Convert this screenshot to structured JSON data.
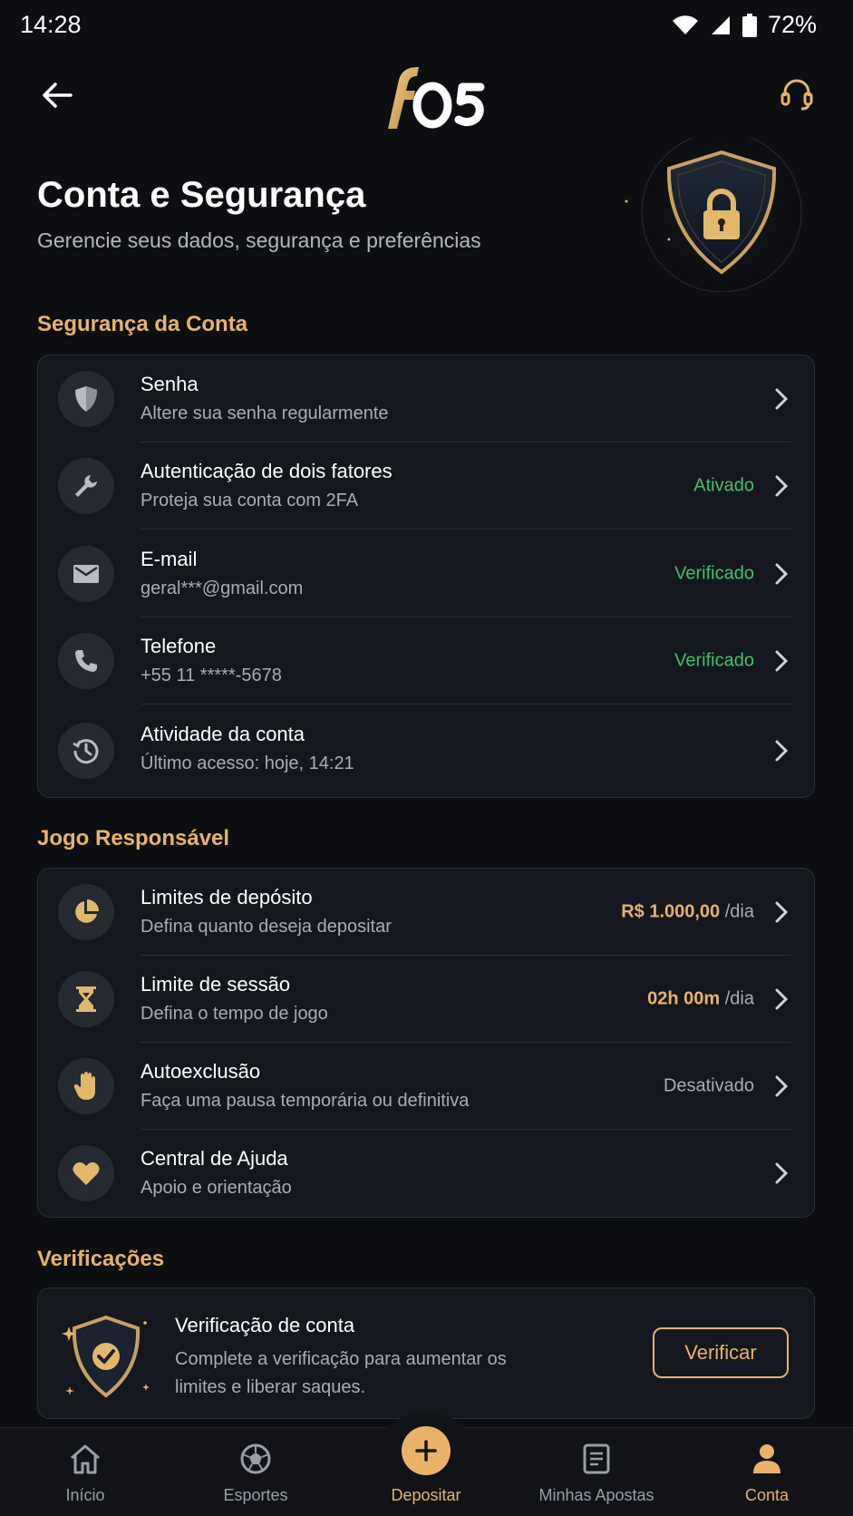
{
  "status_bar": {
    "time": "14:28",
    "battery": "72%"
  },
  "header": {
    "logo_text": "f05"
  },
  "hero": {
    "title": "Conta e Segurança",
    "subtitle": "Gerencie seus dados, segurança e preferências"
  },
  "sections": {
    "security_title": "Segurança da Conta",
    "responsible_title": "Jogo Responsável",
    "verifications_title": "Verificações"
  },
  "security_rows": [
    {
      "title": "Senha",
      "subtitle": "Altere sua senha regularmente",
      "status": ""
    },
    {
      "title": "Autenticação de dois fatores",
      "subtitle": "Proteja sua conta com 2FA",
      "status": "Ativado"
    },
    {
      "title": "E-mail",
      "subtitle": "geral***@gmail.com",
      "status": "Verificado"
    },
    {
      "title": "Telefone",
      "subtitle": "+55 11 *****-5678",
      "status": "Verificado"
    },
    {
      "title": "Atividade da conta",
      "subtitle": "Último acesso: hoje, 14:21",
      "status": ""
    }
  ],
  "responsible_rows": [
    {
      "title": "Limites de depósito",
      "subtitle": "Defina quanto deseja depositar",
      "status": "R$ 1.000,00",
      "unit": "/dia"
    },
    {
      "title": "Limite de sessão",
      "subtitle": "Defina o tempo de jogo",
      "status": "02h 00m",
      "unit": "/dia"
    },
    {
      "title": "Autoexclusão",
      "subtitle": "Faça uma pausa temporária ou definitiva",
      "status": "Desativado"
    },
    {
      "title": "Central de Ajuda",
      "subtitle": "Apoio e orientação",
      "status": ""
    }
  ],
  "verification": {
    "title": "Verificação de conta",
    "text": "Complete a verificação para aumentar os limites e liberar saques.",
    "button": "Verificar"
  },
  "bottom_nav": [
    {
      "label": "Início",
      "icon": "home-icon"
    },
    {
      "label": "Esportes",
      "icon": "soccer-ball-icon"
    },
    {
      "label": "Depositar",
      "icon": "plus-icon"
    },
    {
      "label": "Minhas Apostas",
      "icon": "receipt-icon"
    },
    {
      "label": "Conta",
      "icon": "user-icon"
    }
  ],
  "colors": {
    "background": "#0c0e12",
    "accent_gold": "#e8b366",
    "status_green": "#3fc26b",
    "card": "#14171d"
  }
}
